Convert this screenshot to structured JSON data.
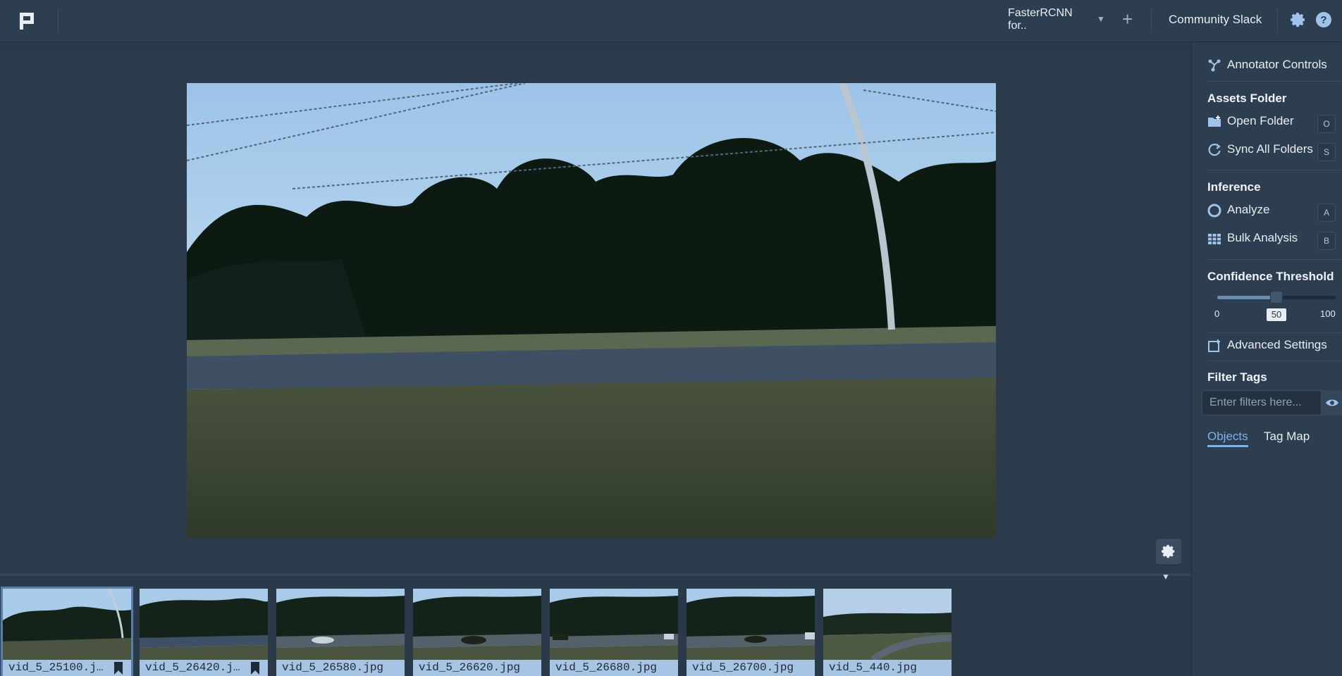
{
  "header": {
    "model_name": "FasterRCNN for..",
    "community_link": "Community Slack"
  },
  "panel": {
    "title": "Annotator Controls",
    "assets_section": "Assets Folder",
    "open_folder": "Open Folder",
    "open_folder_key": "O",
    "sync_folders": "Sync All Folders",
    "sync_folders_key": "S",
    "inference_section": "Inference",
    "analyze": "Analyze",
    "analyze_key": "A",
    "bulk_analysis": "Bulk Analysis",
    "bulk_analysis_key": "B",
    "confidence_section": "Confidence Threshold",
    "slider_min": "0",
    "slider_max": "100",
    "slider_value": "50",
    "slider_fraction": 0.5,
    "advanced_settings": "Advanced Settings",
    "filter_section": "Filter Tags",
    "filter_placeholder": "Enter filters here...",
    "tabs": [
      {
        "label": "Objects",
        "active": true
      },
      {
        "label": "Tag Map",
        "active": false
      }
    ]
  },
  "filmstrip": [
    {
      "label": "vid_5_25100.j…",
      "bookmarked": true,
      "selected": true
    },
    {
      "label": "vid_5_26420.j…",
      "bookmarked": true,
      "selected": false
    },
    {
      "label": "vid_5_26580.jpg",
      "bookmarked": false,
      "selected": false
    },
    {
      "label": "vid_5_26620.jpg",
      "bookmarked": false,
      "selected": false
    },
    {
      "label": "vid_5_26680.jpg",
      "bookmarked": false,
      "selected": false
    },
    {
      "label": "vid_5_26700.jpg",
      "bookmarked": false,
      "selected": false
    },
    {
      "label": "vid_5_440.jpg",
      "bookmarked": false,
      "selected": false
    }
  ],
  "colors": {
    "accent": "#7fb1e8",
    "background": "#2a3a4b",
    "thumb_label": "#a8c4e4"
  },
  "icons": {
    "logo": "app-logo-icon",
    "settings": "gear-icon",
    "help": "help-icon",
    "add": "plus-icon",
    "caret": "caret-down-icon",
    "controls": "branch-icon",
    "open_folder": "folder-plus-icon",
    "sync": "refresh-icon",
    "analyze": "circle-icon",
    "bulk": "grid-icon",
    "advanced": "settings-panel-icon",
    "eye": "eye-icon",
    "bookmark": "bookmark-icon"
  }
}
